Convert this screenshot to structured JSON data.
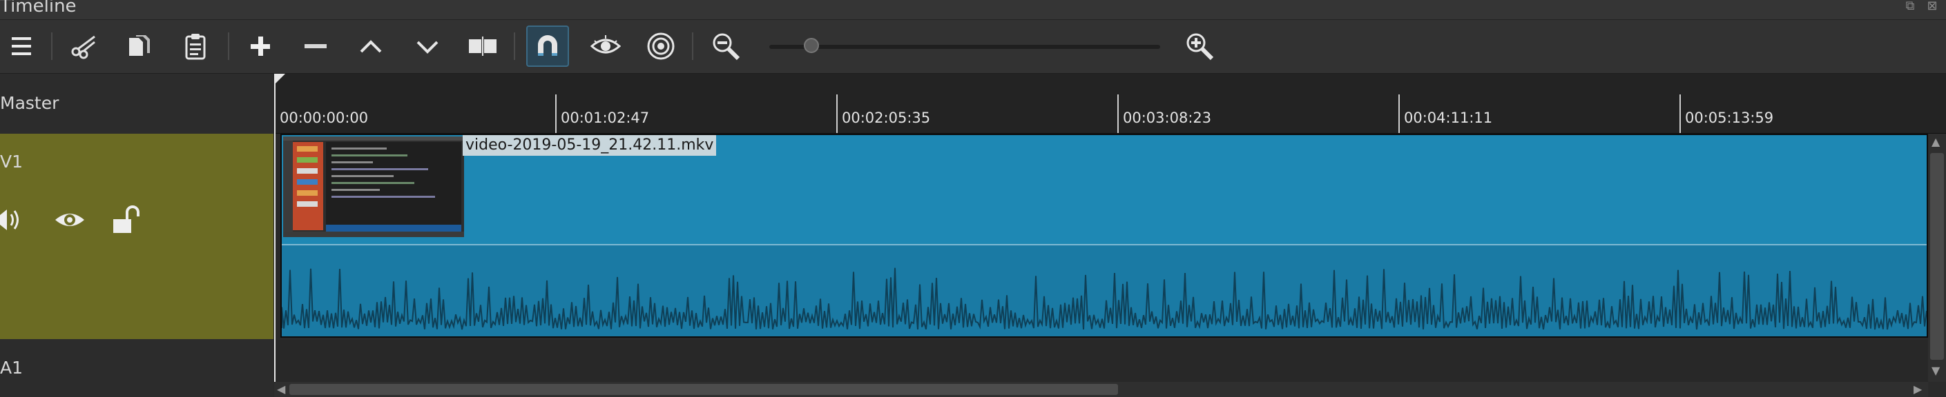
{
  "window": {
    "title": "Timeline"
  },
  "toolbar": {
    "buttons": [
      {
        "name": "menu-button",
        "icon": "hamburger-icon"
      },
      {
        "name": "cut-button",
        "icon": "scissors-icon"
      },
      {
        "name": "copy-button",
        "icon": "copy-icon"
      },
      {
        "name": "paste-button",
        "icon": "clipboard-icon"
      },
      {
        "name": "append-button",
        "icon": "plus-icon"
      },
      {
        "name": "remove-button",
        "icon": "minus-icon"
      },
      {
        "name": "lift-button",
        "icon": "chevron-up-icon"
      },
      {
        "name": "overwrite-button",
        "icon": "chevron-down-icon"
      },
      {
        "name": "split-button",
        "icon": "split-icon"
      },
      {
        "name": "snap-button",
        "icon": "magnet-icon",
        "active": true
      },
      {
        "name": "scrub-button",
        "icon": "eye-icon"
      },
      {
        "name": "ripple-button",
        "icon": "target-icon"
      },
      {
        "name": "zoom-out-button",
        "icon": "zoom-out-icon"
      },
      {
        "name": "zoom-in-button",
        "icon": "zoom-in-icon"
      }
    ],
    "zoom_level": 0.06
  },
  "tracks": {
    "master": {
      "label": "Master"
    },
    "v1": {
      "label": "V1"
    },
    "a1": {
      "label": "A1"
    }
  },
  "ruler": {
    "ticks": [
      "00:00:00:00",
      "00:01:02:47",
      "00:02:05:35",
      "00:03:08:23",
      "00:04:11:11",
      "00:05:13:59"
    ]
  },
  "clip": {
    "label": "video-2019-05-19_21.42.11.mkv"
  },
  "colors": {
    "track_header": "#6b6b23",
    "clip": "#1e88b4",
    "accent": "#3b6a85"
  }
}
